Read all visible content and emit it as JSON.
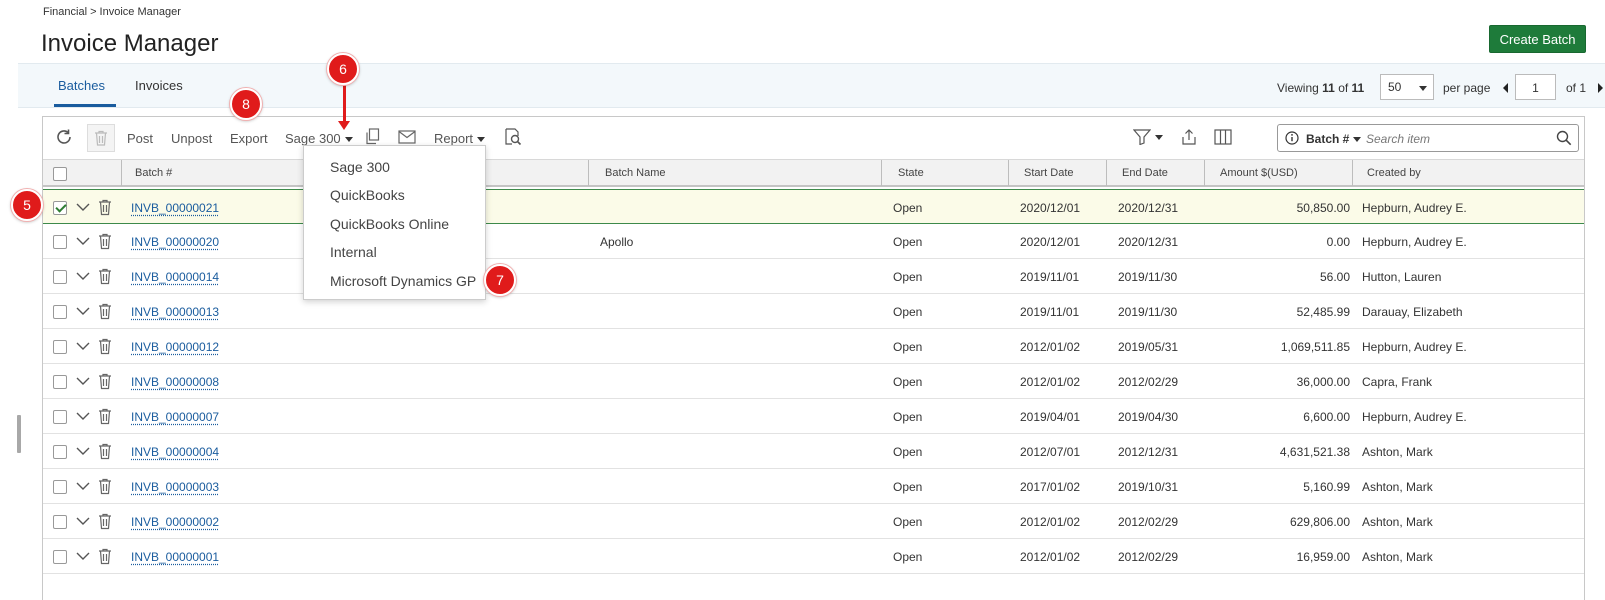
{
  "breadcrumb": "Financial > Invoice Manager",
  "title": "Invoice Manager",
  "create_button": "Create Batch",
  "tabs": [
    {
      "label": "Batches",
      "active": true
    },
    {
      "label": "Invoices",
      "active": false
    }
  ],
  "pagination": {
    "viewing_label": "Viewing",
    "shown": "11",
    "of_label": "of",
    "total": "11",
    "per_page_value": "50",
    "per_page_label": "per page",
    "page": "1",
    "of_pages": "of 1"
  },
  "toolbar": {
    "post": "Post",
    "unpost": "Unpost",
    "export": "Export",
    "export_target": "Sage 300",
    "report": "Report",
    "search_field": "Batch #",
    "search_placeholder": "Search item"
  },
  "export_menu": [
    "Sage 300",
    "QuickBooks",
    "QuickBooks Online",
    "Internal",
    "Microsoft Dynamics GP"
  ],
  "columns": [
    "Batch #",
    "Batch Name",
    "State",
    "Start Date",
    "End Date",
    "Amount $(USD)",
    "Created by"
  ],
  "rows": [
    {
      "batch": "INVB_00000021",
      "name": "",
      "state": "Open",
      "start": "2020/12/01",
      "end": "2020/12/31",
      "amount": "50,850.00",
      "created_by": "Hepburn, Audrey E.",
      "selected": true
    },
    {
      "batch": "INVB_00000020",
      "name": "Apollo",
      "state": "Open",
      "start": "2020/12/01",
      "end": "2020/12/31",
      "amount": "0.00",
      "created_by": "Hepburn, Audrey E.",
      "selected": false
    },
    {
      "batch": "INVB_00000014",
      "name": "",
      "state": "Open",
      "start": "2019/11/01",
      "end": "2019/11/30",
      "amount": "56.00",
      "created_by": "Hutton, Lauren",
      "selected": false
    },
    {
      "batch": "INVB_00000013",
      "name": "",
      "state": "Open",
      "start": "2019/11/01",
      "end": "2019/11/30",
      "amount": "52,485.99",
      "created_by": "Darauay, Elizabeth",
      "selected": false
    },
    {
      "batch": "INVB_00000012",
      "name": "",
      "state": "Open",
      "start": "2012/01/02",
      "end": "2019/05/31",
      "amount": "1,069,511.85",
      "created_by": "Hepburn, Audrey E.",
      "selected": false
    },
    {
      "batch": "INVB_00000008",
      "name": "",
      "state": "Open",
      "start": "2012/01/02",
      "end": "2012/02/29",
      "amount": "36,000.00",
      "created_by": "Capra, Frank",
      "selected": false
    },
    {
      "batch": "INVB_00000007",
      "name": "",
      "state": "Open",
      "start": "2019/04/01",
      "end": "2019/04/30",
      "amount": "6,600.00",
      "created_by": "Hepburn, Audrey E.",
      "selected": false
    },
    {
      "batch": "INVB_00000004",
      "name": "",
      "state": "Open",
      "start": "2012/07/01",
      "end": "2012/12/31",
      "amount": "4,631,521.38",
      "created_by": "Ashton, Mark",
      "selected": false
    },
    {
      "batch": "INVB_00000003",
      "name": "",
      "state": "Open",
      "start": "2017/01/02",
      "end": "2019/10/31",
      "amount": "5,160.99",
      "created_by": "Ashton, Mark",
      "selected": false
    },
    {
      "batch": "INVB_00000002",
      "name": "",
      "state": "Open",
      "start": "2012/01/02",
      "end": "2012/02/29",
      "amount": "629,806.00",
      "created_by": "Ashton, Mark",
      "selected": false
    },
    {
      "batch": "INVB_00000001",
      "name": "",
      "state": "Open",
      "start": "2012/01/02",
      "end": "2012/02/29",
      "amount": "16,959.00",
      "created_by": "Ashton, Mark",
      "selected": false
    }
  ],
  "callouts": [
    "5",
    "6",
    "7",
    "8"
  ],
  "colors": {
    "accent": "#1a5c9e",
    "create": "#1e7b3a",
    "callout": "#e01b1b",
    "selected_border": "#3d8a4a"
  }
}
